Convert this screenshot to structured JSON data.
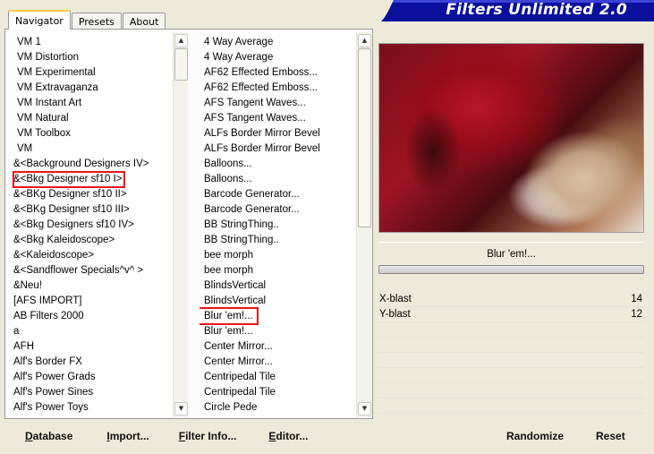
{
  "tabs": [
    "Navigator",
    "Presets",
    "About"
  ],
  "app_title": "Filters Unlimited 2.0",
  "categories": {
    "items": [
      "VM 1",
      "VM Distortion",
      "VM Experimental",
      "VM Extravaganza",
      "VM Instant Art",
      "VM Natural",
      "VM Toolbox",
      "VM",
      "&<Background Designers IV>",
      "&<Bkg Designer sf10 I>",
      "&<BKg Designer sf10 II>",
      "&<BKg Designer sf10 III>",
      "&<Bkg Designers sf10 IV>",
      "&<Bkg Kaleidoscope>",
      "&<Kaleidoscope>",
      "&<Sandflower Specials^v^ >",
      "&Neu!",
      "[AFS IMPORT]",
      "AB Filters 2000",
      "a",
      "AFH",
      "Alf's Border FX",
      "Alf's Power Grads",
      "Alf's Power Sines",
      "Alf's Power Toys"
    ],
    "selected": "&<Bkg Designer sf10 I>"
  },
  "filters": {
    "items": [
      "4 Way Average",
      "4 Way Average",
      "AF62 Effected Emboss...",
      "AF62 Effected Emboss...",
      "AFS Tangent Waves...",
      "AFS Tangent Waves...",
      "ALFs Border Mirror Bevel",
      "ALFs Border Mirror Bevel",
      "Balloons...",
      "Balloons...",
      "Barcode Generator...",
      "Barcode Generator...",
      "BB StringThing..",
      "BB StringThing..",
      "bee morph",
      "bee morph",
      "BlindsVertical",
      "BlindsVertical",
      "Blur 'em!...",
      "Blur 'em!...",
      "Center Mirror...",
      "Center Mirror...",
      "Centripedal Tile",
      "Centripedal Tile",
      "Circle Pede"
    ],
    "selected": "Blur 'em!..."
  },
  "preview": {
    "filter_name": "Blur 'em!..."
  },
  "params": [
    {
      "name": "X-blast",
      "value": "14"
    },
    {
      "name": "Y-blast",
      "value": "12"
    }
  ],
  "buttons": {
    "database": {
      "u": "D",
      "rest": "atabase"
    },
    "import": {
      "u": "I",
      "rest": "mport..."
    },
    "filter_info": {
      "u": "F",
      "rest": "ilter Info..."
    },
    "editor": {
      "u": "E",
      "rest": "ditor..."
    },
    "randomize": "Randomize",
    "reset": "Reset"
  },
  "colors": {
    "banner": "#0a0f9c",
    "highlight": "#e8141c",
    "tab_accent": "#ffc83c"
  },
  "icons": {
    "scroll_up": "scroll-up-icon",
    "scroll_down": "scroll-down-icon"
  }
}
